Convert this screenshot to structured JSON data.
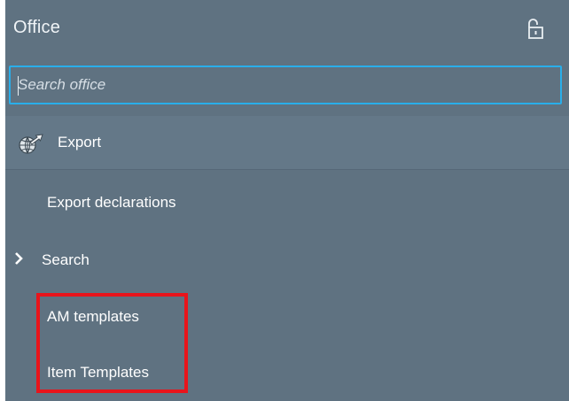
{
  "header": {
    "title": "Office"
  },
  "search": {
    "placeholder": "Search office",
    "value": ""
  },
  "section": {
    "label": "Export"
  },
  "nav": {
    "items": [
      {
        "label": "Export declarations"
      },
      {
        "label": "Search"
      },
      {
        "label": "AM templates"
      },
      {
        "label": "Item Templates"
      }
    ]
  },
  "colors": {
    "panel": "#5f7281",
    "section_header": "#647888",
    "focus_border": "#29aeea",
    "highlight": "#e8141b",
    "text": "#ffffff"
  },
  "icons": {
    "header_action": "unlock-icon",
    "section": "globe-export-icon",
    "expander": "chevron-right-icon"
  }
}
